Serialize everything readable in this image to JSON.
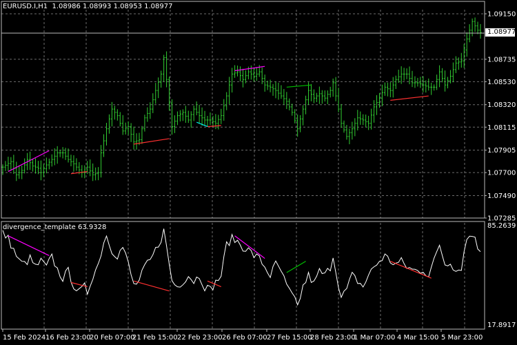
{
  "symbol": "EURUSD.I,H1",
  "ohlc": "1.08986 1.08993 1.08953 1.08977",
  "current_price": "1.08977",
  "indicator": {
    "name": "divergence_template",
    "value": "63.9328",
    "max_label": "85.2639",
    "min_label": "17.8917"
  },
  "colors": {
    "background": "#000000",
    "grid": "#6e6e6e",
    "price_bars": "#32cd32",
    "indicator_line": "#ffffff",
    "bearish_divergence": "#ff00ff",
    "bullish_divergence": "#ff3030",
    "hidden_bullish": "#00ffff",
    "hidden_bearish": "#00c000"
  },
  "price_axis_labels": [
    "1.09150",
    "1.08977",
    "1.08735",
    "1.08530",
    "1.08320",
    "1.08115",
    "1.07905",
    "1.07700",
    "1.07490",
    "1.07285"
  ],
  "time_axis_labels": [
    "15 Feb 2024",
    "16 Feb 23:00",
    "20 Feb 07:00",
    "21 Feb 15:00",
    "22 Feb 23:00",
    "26 Feb 07:00",
    "27 Feb 15:00",
    "28 Feb 23:00",
    "1 Mar 07:00",
    "4 Mar 15:00",
    "5 Mar 23:00"
  ],
  "chart_data": [
    {
      "type": "bar",
      "title": "EURUSD.I,H1",
      "y_range": [
        1.07285,
        1.0915
      ],
      "y_ticks": [
        1.0915,
        1.08735,
        1.0853,
        1.0832,
        1.08115,
        1.07905,
        1.077,
        1.0749,
        1.07285
      ],
      "x_ticks": [
        "15 Feb 2024",
        "16 Feb 23:00",
        "20 Feb 07:00",
        "21 Feb 15:00",
        "22 Feb 23:00",
        "26 Feb 07:00",
        "27 Feb 15:00",
        "28 Feb 23:00",
        "1 Mar 07:00",
        "4 Mar 15:00",
        "5 Mar 23:00"
      ],
      "series": [
        {
          "anchors": [
            [
              0,
              1.0775
            ],
            [
              3,
              1.078
            ],
            [
              5,
              1.0768
            ],
            [
              7,
              1.0772
            ],
            [
              9,
              1.0782
            ],
            [
              11,
              1.0776
            ],
            [
              13,
              1.0774
            ],
            [
              14,
              1.077
            ],
            [
              16,
              1.0777
            ],
            [
              18,
              1.0782
            ],
            [
              20,
              1.0788
            ],
            [
              22,
              1.0788
            ],
            [
              24,
              1.0782
            ],
            [
              26,
              1.0778
            ],
            [
              27,
              1.0775
            ],
            [
              29,
              1.077
            ],
            [
              31,
              1.0775
            ],
            [
              33,
              1.0768
            ],
            [
              35,
              1.077
            ],
            [
              36,
              1.0788
            ],
            [
              38,
              1.081
            ],
            [
              40,
              1.0828
            ],
            [
              42,
              1.0822
            ],
            [
              44,
              1.0808
            ],
            [
              46,
              1.0812
            ],
            [
              48,
              1.0798
            ],
            [
              50,
              1.08
            ],
            [
              52,
              1.082
            ],
            [
              54,
              1.0828
            ],
            [
              56,
              1.0845
            ],
            [
              58,
              1.086
            ],
            [
              59,
              1.0875
            ],
            [
              60,
              1.0855
            ],
            [
              62,
              1.0812
            ],
            [
              64,
              1.0822
            ],
            [
              66,
              1.0825
            ],
            [
              68,
              1.0818
            ],
            [
              70,
              1.0828
            ],
            [
              72,
              1.0822
            ],
            [
              74,
              1.0818
            ],
            [
              76,
              1.0818
            ],
            [
              78,
              1.0815
            ],
            [
              80,
              1.0822
            ],
            [
              82,
              1.084
            ],
            [
              84,
              1.086
            ],
            [
              86,
              1.0862
            ],
            [
              88,
              1.0855
            ],
            [
              90,
              1.0862
            ],
            [
              92,
              1.0858
            ],
            [
              94,
              1.0862
            ],
            [
              96,
              1.085
            ],
            [
              98,
              1.0848
            ],
            [
              100,
              1.0845
            ],
            [
              102,
              1.084
            ],
            [
              104,
              1.0835
            ],
            [
              106,
              1.0825
            ],
            [
              108,
              1.081
            ],
            [
              110,
              1.0828
            ],
            [
              112,
              1.0845
            ],
            [
              114,
              1.0838
            ],
            [
              116,
              1.0842
            ],
            [
              118,
              1.0838
            ],
            [
              120,
              1.0845
            ],
            [
              121,
              1.0852
            ],
            [
              123,
              1.0828
            ],
            [
              124,
              1.0815
            ],
            [
              126,
              1.0803
            ],
            [
              128,
              1.081
            ],
            [
              130,
              1.082
            ],
            [
              132,
              1.0818
            ],
            [
              134,
              1.0815
            ],
            [
              136,
              1.083
            ],
            [
              138,
              1.0838
            ],
            [
              140,
              1.0848
            ],
            [
              142,
              1.0845
            ],
            [
              144,
              1.0855
            ],
            [
              146,
              1.086
            ],
            [
              148,
              1.086
            ],
            [
              150,
              1.0852
            ],
            [
              152,
              1.0852
            ],
            [
              154,
              1.085
            ],
            [
              156,
              1.0848
            ],
            [
              158,
              1.0848
            ],
            [
              160,
              1.0862
            ],
            [
              162,
              1.085
            ],
            [
              164,
              1.0858
            ],
            [
              166,
              1.087
            ],
            [
              168,
              1.0872
            ],
            [
              170,
              1.0892
            ],
            [
              172,
              1.0908
            ],
            [
              174,
              1.09
            ],
            [
              175,
              1.0898
            ]
          ],
          "color": "#32cd32"
        }
      ],
      "lines": [
        {
          "color": "#ff00ff",
          "from": [
            2,
            1.0771
          ],
          "to": [
            17,
            1.079
          ]
        },
        {
          "color": "#ff3030",
          "from": [
            25,
            1.0769
          ],
          "to": [
            31,
            1.0771
          ]
        },
        {
          "color": "#ff3030",
          "from": [
            48,
            1.0796
          ],
          "to": [
            61,
            1.0801
          ]
        },
        {
          "color": "#00ffff",
          "from": [
            71,
            1.0816
          ],
          "to": [
            75,
            1.0812
          ]
        },
        {
          "color": "#ff3030",
          "from": [
            75,
            1.0812
          ],
          "to": [
            80,
            1.0813
          ]
        },
        {
          "color": "#ff00ff",
          "from": [
            85,
            1.0863
          ],
          "to": [
            96,
            1.0867
          ]
        },
        {
          "color": "#00c000",
          "from": [
            104,
            1.0848
          ],
          "to": [
            113,
            1.085
          ]
        },
        {
          "color": "#ff3030",
          "from": [
            142,
            1.0836
          ],
          "to": [
            156,
            1.084
          ]
        }
      ]
    },
    {
      "type": "line",
      "title": "divergence_template 63.9328",
      "y_range": [
        17.8917,
        85.2639
      ],
      "y_ticks": [
        85.2639,
        17.8917
      ],
      "series": [
        {
          "anchors": [
            [
              0,
              82
            ],
            [
              2,
              78
            ],
            [
              4,
              70
            ],
            [
              6,
              62
            ],
            [
              8,
              60
            ],
            [
              10,
              64
            ],
            [
              12,
              58
            ],
            [
              14,
              62
            ],
            [
              16,
              58
            ],
            [
              18,
              65
            ],
            [
              20,
              56
            ],
            [
              22,
              50
            ],
            [
              24,
              55
            ],
            [
              26,
              45
            ],
            [
              28,
              40
            ],
            [
              30,
              44
            ],
            [
              31,
              40
            ],
            [
              33,
              52
            ],
            [
              35,
              60
            ],
            [
              37,
              76
            ],
            [
              38,
              80
            ],
            [
              40,
              70
            ],
            [
              42,
              66
            ],
            [
              44,
              72
            ],
            [
              46,
              60
            ],
            [
              48,
              45
            ],
            [
              50,
              48
            ],
            [
              52,
              58
            ],
            [
              54,
              62
            ],
            [
              56,
              70
            ],
            [
              58,
              78
            ],
            [
              59,
              85
            ],
            [
              60,
              72
            ],
            [
              62,
              48
            ],
            [
              64,
              44
            ],
            [
              66,
              48
            ],
            [
              68,
              52
            ],
            [
              70,
              48
            ],
            [
              72,
              52
            ],
            [
              74,
              44
            ],
            [
              76,
              42
            ],
            [
              78,
              47
            ],
            [
              80,
              52
            ],
            [
              82,
              74
            ],
            [
              84,
              78
            ],
            [
              86,
              76
            ],
            [
              88,
              72
            ],
            [
              90,
              70
            ],
            [
              92,
              66
            ],
            [
              94,
              64
            ],
            [
              96,
              58
            ],
            [
              98,
              52
            ],
            [
              100,
              60
            ],
            [
              102,
              55
            ],
            [
              104,
              44
            ],
            [
              106,
              38
            ],
            [
              108,
              30
            ],
            [
              110,
              44
            ],
            [
              112,
              52
            ],
            [
              114,
              46
            ],
            [
              116,
              55
            ],
            [
              118,
              52
            ],
            [
              120,
              58
            ],
            [
              121,
              66
            ],
            [
              123,
              46
            ],
            [
              124,
              36
            ],
            [
              126,
              42
            ],
            [
              128,
              52
            ],
            [
              130,
              48
            ],
            [
              132,
              44
            ],
            [
              134,
              52
            ],
            [
              136,
              58
            ],
            [
              138,
              62
            ],
            [
              140,
              66
            ],
            [
              142,
              62
            ],
            [
              144,
              60
            ],
            [
              146,
              62
            ],
            [
              148,
              58
            ],
            [
              150,
              56
            ],
            [
              152,
              55
            ],
            [
              154,
              56
            ],
            [
              156,
              52
            ],
            [
              158,
              62
            ],
            [
              160,
              74
            ],
            [
              162,
              60
            ],
            [
              164,
              62
            ],
            [
              166,
              55
            ],
            [
              168,
              58
            ],
            [
              170,
              78
            ],
            [
              172,
              82
            ],
            [
              174,
              72
            ],
            [
              175,
              70
            ]
          ],
          "color": "#ffffff"
        }
      ],
      "lines": [
        {
          "color": "#ff00ff",
          "from": [
            2,
            80
          ],
          "to": [
            17,
            66
          ]
        },
        {
          "color": "#ff3030",
          "from": [
            25,
            47
          ],
          "to": [
            31,
            44
          ]
        },
        {
          "color": "#ff3030",
          "from": [
            48,
            48
          ],
          "to": [
            61,
            41
          ]
        },
        {
          "color": "#ff3030",
          "from": [
            75,
            48
          ],
          "to": [
            80,
            44
          ]
        },
        {
          "color": "#ff00ff",
          "from": [
            85,
            80
          ],
          "to": [
            96,
            64
          ]
        },
        {
          "color": "#00c000",
          "from": [
            104,
            54
          ],
          "to": [
            111,
            62
          ]
        },
        {
          "color": "#ff3030",
          "from": [
            142,
            62
          ],
          "to": [
            157,
            50
          ]
        }
      ]
    }
  ]
}
